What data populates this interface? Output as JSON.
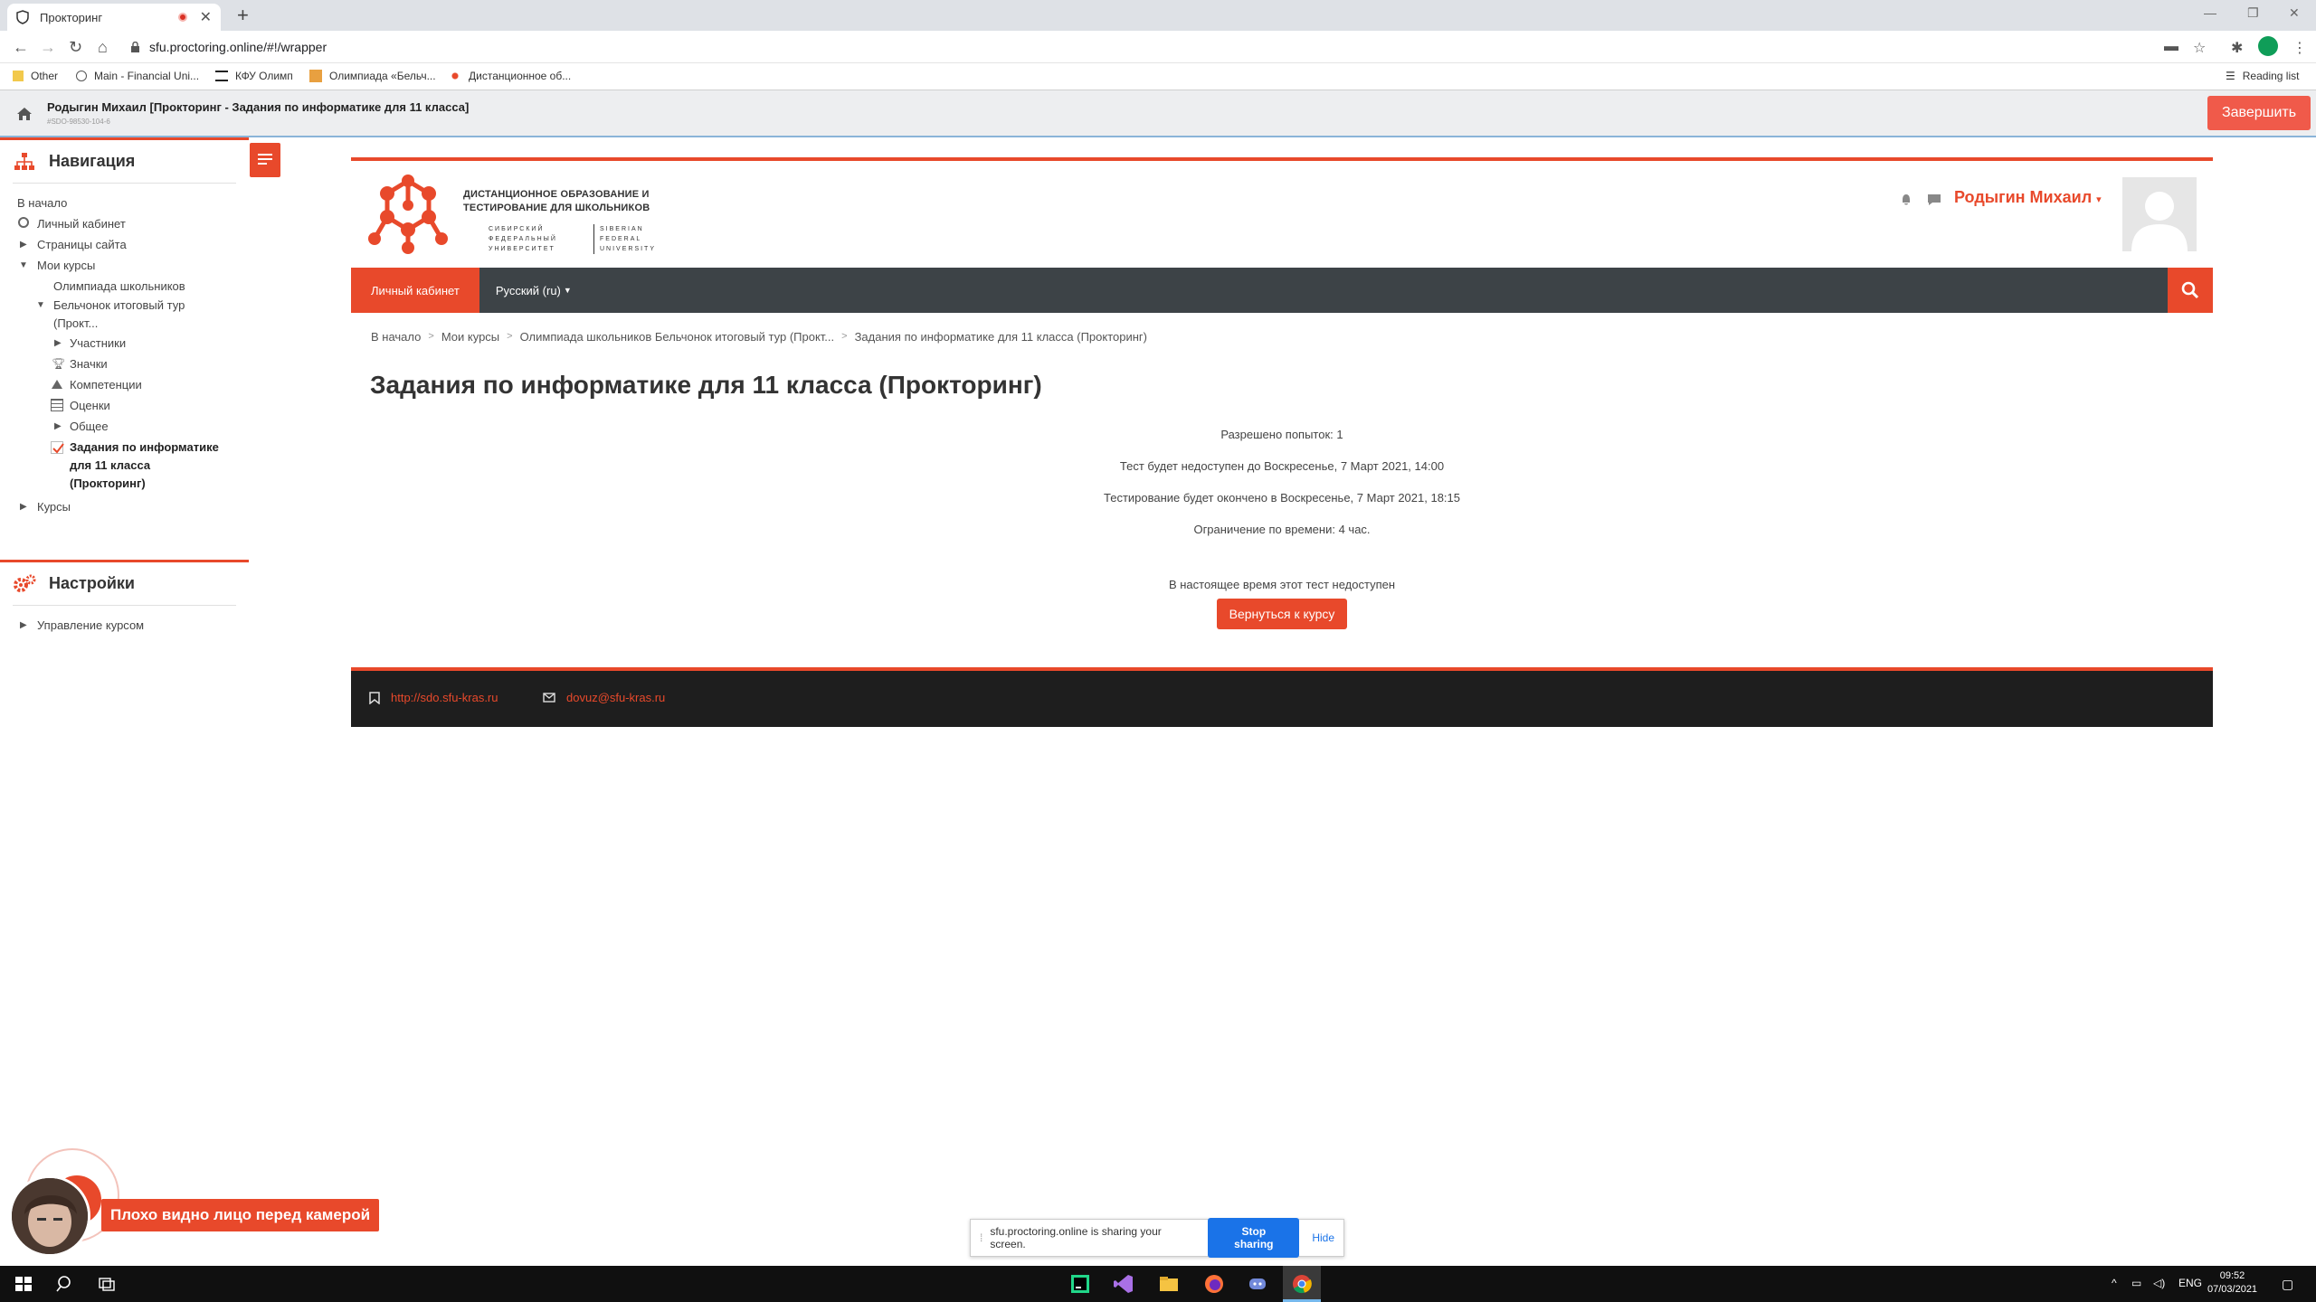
{
  "browser": {
    "tab_title": "Прокторинг",
    "url": "sfu.proctoring.online/#!/wrapper",
    "reading_list": "Reading list",
    "bookmarks": [
      "Other",
      "Main - Financial Uni...",
      "КФУ Олимп",
      "Олимпиада «Бельч...",
      "Дистанционное об..."
    ]
  },
  "proctor": {
    "title": "Родыгин Михаил [Прокторинг - Задания по информатике для 11 класса]",
    "session_id": "#SDO-98530-104-6",
    "finish_label": "Завершить"
  },
  "sidebar": {
    "nav_title": "Навигация",
    "items": {
      "home": "В начало",
      "dashboard": "Личный кабинет",
      "site_pages": "Страницы сайта",
      "my_courses": "Мои курсы",
      "olympiad": "Олимпиада школьников",
      "belchonok_1": "Бельчонок итоговый тур",
      "belchonok_2": "(Прокт...",
      "participants": "Участники",
      "badges": "Значки",
      "competencies": "Компетенции",
      "grades": "Оценки",
      "general": "Общее",
      "quiz_1": "Задания по информатике",
      "quiz_2": "для 11 класса",
      "quiz_3": "(Прокторинг)",
      "courses": "Курсы"
    },
    "settings_title": "Настройки",
    "course_admin": "Управление курсом"
  },
  "brand": {
    "line1": "ДИСТАНЦИОННОЕ ОБРАЗОВАНИЕ И",
    "line2": "ТЕСТИРОВАНИЕ ДЛЯ ШКОЛЬНИКОВ",
    "ru1": "СИБИРСКИЙ",
    "ru2": "ФЕДЕРАЛЬНЫЙ",
    "ru3": "УНИВЕРСИТЕТ",
    "en1": "SIBERIAN",
    "en2": "FEDERAL",
    "en3": "UNIVERSITY",
    "color": "#e8492b"
  },
  "user": {
    "name": "Родыгин Михаил"
  },
  "navbar": {
    "dashboard": "Личный кабинет",
    "language": "Русский (ru)"
  },
  "breadcrumb": [
    "В начало",
    "Мои курсы",
    "Олимпиада школьников Бельчонок итоговый тур (Прокт...",
    "Задания по информатике для 11 класса (Прокторинг)"
  ],
  "quiz": {
    "title": "Задания по информатике для 11 класса (Прокторинг)",
    "attempts": "Разрешено попыток: 1",
    "opens": "Тест будет недоступен до Воскресенье, 7 Март 2021, 14:00",
    "closes": "Тестирование будет окончено в Воскресенье, 7 Март 2021, 18:15",
    "time_limit": "Ограничение по времени: 4 час.",
    "unavailable": "В настоящее время этот тест недоступен",
    "back_label": "Вернуться к курсу"
  },
  "footer": {
    "site": "http://sdo.sfu-kras.ru",
    "email": "dovuz@sfu-kras.ru"
  },
  "camera": {
    "warning": "Плохо видно лицо перед камерой"
  },
  "sharing": {
    "text": "sfu.proctoring.online is sharing your screen.",
    "stop_label": "Stop sharing",
    "hide_label": "Hide"
  },
  "taskbar": {
    "lang": "ENG",
    "time": "09:52",
    "date": "07/03/2021"
  }
}
